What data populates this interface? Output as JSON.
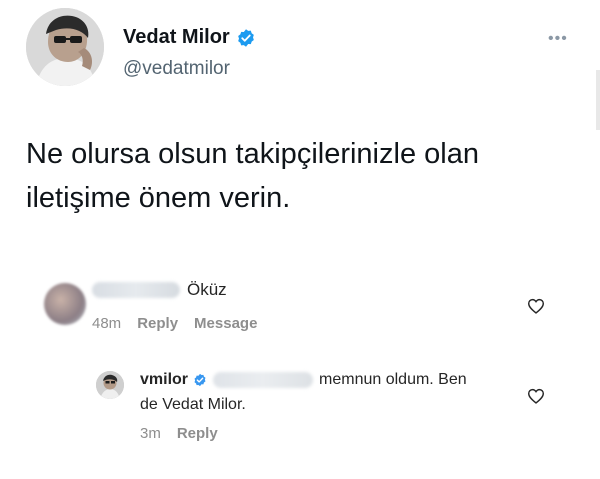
{
  "tweet": {
    "author_name": "Vedat Milor",
    "author_handle": "@vedatmilor",
    "more_icon": "more-horizontal-icon",
    "text": "Ne olursa olsun takipçilerinizle olan iletişime önem verin."
  },
  "comments": [
    {
      "username": "",
      "text": "Öküz",
      "time": "48m",
      "reply_label": "Reply",
      "message_label": "Message"
    },
    {
      "username": "vmilor",
      "text_line1": "memnun oldum. Ben",
      "text_line2": "de Vedat Milor.",
      "time": "3m",
      "reply_label": "Reply"
    }
  ],
  "colors": {
    "verified": "#1d9bf0",
    "instagram_verified": "#3897f0",
    "muted": "#8e8e8e"
  }
}
